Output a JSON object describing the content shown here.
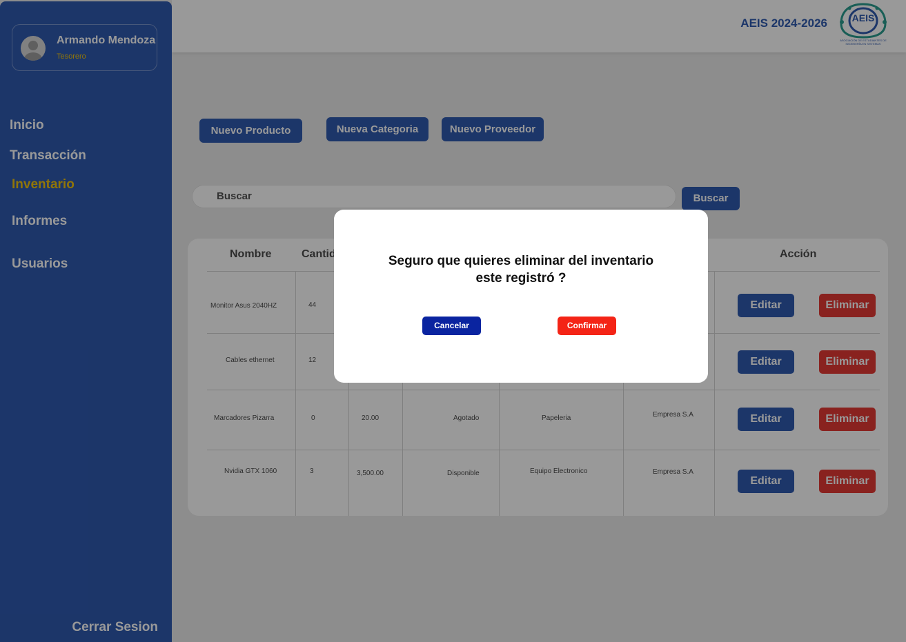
{
  "sidebar": {
    "user": {
      "name": "Armando Mendoza",
      "role": "Tesorero"
    },
    "nav": [
      {
        "label": "Inicio"
      },
      {
        "label": "Transacción"
      },
      {
        "label": "Inventario",
        "active": true
      },
      {
        "label": "Informes"
      },
      {
        "label": "Usuarios"
      }
    ],
    "logout": "Cerrar Sesion"
  },
  "header": {
    "title": "AEIS 2024-2026",
    "logo_text": "AEIS",
    "logo_subtitle": "ASOCIACIÓN DE ESTUDIANTES DE INGENIERÍA EN SISTEMAS"
  },
  "actions": {
    "new_product": "Nuevo Producto",
    "new_category": "Nueva Categoria",
    "new_supplier": "Nuevo Proveedor"
  },
  "search": {
    "placeholder": "Buscar",
    "button": "Buscar"
  },
  "table": {
    "headers": {
      "nombre": "Nombre",
      "cantidad": "Cantid",
      "accion": "Acción"
    },
    "rows": [
      {
        "nombre": "Monitor Asus 2040HZ",
        "cantidad": "44",
        "precio": "",
        "estado": "",
        "categoria": "",
        "proveedor": ""
      },
      {
        "nombre": "Cables ethernet",
        "cantidad": "12",
        "precio": "",
        "estado": "",
        "categoria": "",
        "proveedor": ""
      },
      {
        "nombre": "Marcadores Pizarra",
        "cantidad": "0",
        "precio": "20.00",
        "estado": "Agotado",
        "categoria": "Papeleria",
        "proveedor": "Empresa S.A"
      },
      {
        "nombre": "Nvidia GTX 1060",
        "cantidad": "3",
        "precio": "3,500.00",
        "estado": "Disponible",
        "categoria": "Equipo Electronico",
        "proveedor": "Empresa S.A"
      }
    ],
    "edit_label": "Editar",
    "delete_label": "Eliminar"
  },
  "modal": {
    "line1": "Seguro que quieres eliminar del inventario",
    "line2": "este registró  ?",
    "cancel": "Cancelar",
    "confirm": "Confirmar"
  },
  "colors": {
    "primary": "#2f5ab0",
    "accent": "#f1c40f",
    "danger": "#e53935",
    "cancel": "#0a24a0",
    "confirm": "#f42416"
  }
}
